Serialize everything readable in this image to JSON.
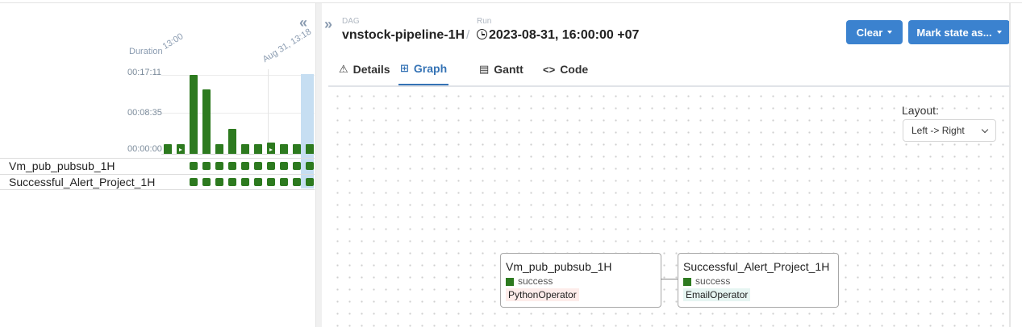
{
  "grid": {
    "collapse_icon": "double-chevron-left-icon",
    "duration_label": "Duration",
    "run_labels": [
      "13:00",
      "Aug 31, 13:18"
    ],
    "y_ticks": [
      "00:17:11",
      "00:08:35",
      "00:00:00"
    ],
    "tasks": [
      {
        "name": "Vm_pub_pubsub_1H",
        "states": [
          "success",
          "success",
          "success",
          "success",
          "success",
          "success",
          "success",
          "success",
          "success",
          "success"
        ]
      },
      {
        "name": "Successful_Alert_Project_1H",
        "states": [
          "success",
          "success",
          "success",
          "success",
          "success",
          "success",
          "success",
          "success",
          "success",
          "success"
        ]
      }
    ],
    "success_color": "#2d7a1f",
    "selected_color": "#c6def2"
  },
  "chart_data": {
    "type": "bar",
    "title": "",
    "ylabel": "Duration",
    "y_ticks": [
      "00:00:00",
      "00:08:35",
      "00:17:11"
    ],
    "ylim_seconds": [
      0,
      1031
    ],
    "values_seconds": [
      60,
      60,
      1030,
      840,
      70,
      330,
      70,
      70,
      150,
      70,
      70,
      70
    ],
    "manual_trigger_runs": [
      1,
      8
    ],
    "selected_run": 11
  },
  "header": {
    "expand_icon": "double-chevron-right-icon",
    "dag_caption": "DAG",
    "dag_id": "vnstock-pipeline-1H",
    "separator": "/",
    "run_caption": "Run",
    "run_icon": "clock-icon",
    "run_id": "2023-08-31, 16:00:00 +07",
    "clear_label": "Clear",
    "mark_state_label": "Mark state as...",
    "button_color": "#3b82cf"
  },
  "tabs": [
    {
      "label": "Details",
      "icon": "warning-triangle-icon",
      "glyph": "⚠"
    },
    {
      "label": "Graph",
      "icon": "graph-icon",
      "glyph": "⊞"
    },
    {
      "label": "Gantt",
      "icon": "gantt-icon",
      "glyph": "▤"
    },
    {
      "label": "Code",
      "icon": "code-icon",
      "glyph": "<>"
    }
  ],
  "active_tab": "Graph",
  "graph": {
    "layout_label": "Layout:",
    "layout_value": "Left -> Right",
    "nodes": [
      {
        "title": "Vm_pub_pubsub_1H",
        "state": "success",
        "operator": "PythonOperator",
        "operator_bg": "#fdecea"
      },
      {
        "title": "Successful_Alert_Project_1H",
        "state": "success",
        "operator": "EmailOperator",
        "operator_bg": "#e6f5f2"
      }
    ]
  }
}
